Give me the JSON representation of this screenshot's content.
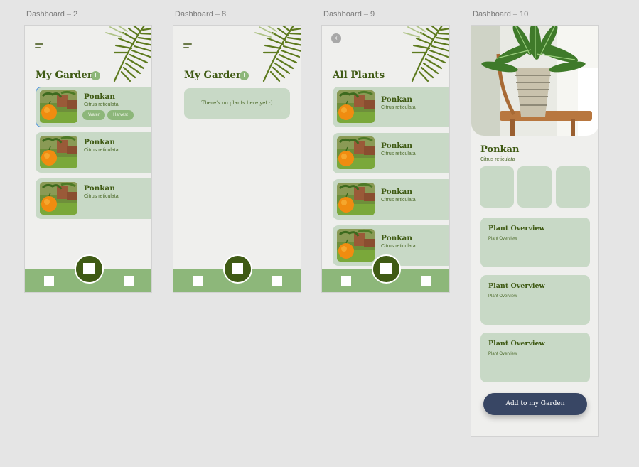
{
  "artboards": {
    "d2": {
      "label": "Dashboard – 2",
      "title": "My Garden",
      "plus": "+"
    },
    "d8": {
      "label": "Dashboard – 8",
      "title": "My Garden",
      "plus": "+",
      "empty_text": "There's no plants here yet :)"
    },
    "d9": {
      "label": "Dashboard – 9",
      "title": "All Plants",
      "back": "‹"
    },
    "d10": {
      "label": "Dashboard – 10",
      "plant_name": "Ponkan",
      "plant_sci": "Citrus reticulata",
      "overviews": [
        {
          "title": "Plant Overview",
          "sub": "Plant Overview"
        },
        {
          "title": "Plant Overview",
          "sub": "Plant Overview"
        },
        {
          "title": "Plant Overview",
          "sub": "Plant Overview"
        }
      ],
      "add_button": "Add to my Garden"
    }
  },
  "plant": {
    "name": "Ponkan",
    "sci": "Citrus reticulata"
  },
  "tags": {
    "water": "Water",
    "harvest": "Harvest"
  },
  "colors": {
    "card": "#c8d9c6",
    "accent": "#8db77a",
    "dark_green": "#3f5a14",
    "button": "#384664",
    "selection": "#4a90e2"
  },
  "icons": [
    "menu-icon",
    "plus-icon",
    "palm-leaf",
    "home-icon",
    "back-icon"
  ]
}
